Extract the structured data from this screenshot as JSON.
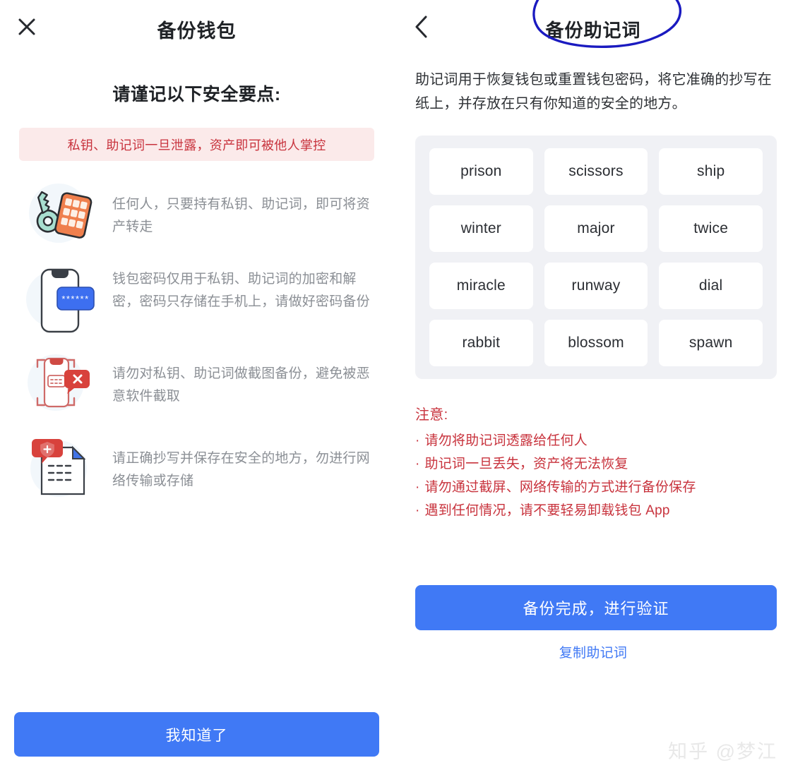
{
  "left_panel": {
    "nav": {
      "close_icon": "close-icon",
      "title": "备份钱包"
    },
    "heading": "请谨记以下安全要点:",
    "alert_banner": {
      "text": "私钥、助记词一旦泄露，资产即可被他人掌控",
      "bg_color": "#fbeaea",
      "text_color": "#c8333d"
    },
    "tips": [
      {
        "icon": "key-and-keypad-icon",
        "text": "任何人，只要持有私钥、助记词，即可将资产转走"
      },
      {
        "icon": "phone-password-icon",
        "text": "钱包密码仅用于私钥、助记词的加密和解密，密码只存储在手机上，请做好密码备份"
      },
      {
        "icon": "no-screenshot-icon",
        "text": "请勿对私钥、助记词做截图备份，避免被恶意软件截取"
      },
      {
        "icon": "secure-document-icon",
        "text": "请正确抄写并保存在安全的地方，勿进行网络传输或存储"
      }
    ],
    "primary_button": "我知道了"
  },
  "right_panel": {
    "nav": {
      "back_icon": "chevron-left-icon",
      "title": "备份助记词"
    },
    "annotation": {
      "shape": "hand-drawn-circle",
      "color": "#1a1ac0"
    },
    "intro": "助记词用于恢复钱包或重置钱包密码，将它准确的抄写在纸上，并存放在只有你知道的安全的地方。",
    "mnemonic_words": [
      "prison",
      "scissors",
      "ship",
      "winter",
      "major",
      "twice",
      "miracle",
      "runway",
      "dial",
      "rabbit",
      "blossom",
      "spawn"
    ],
    "notice": {
      "title": "注意:",
      "items": [
        "请勿将助记词透露给任何人",
        "助记词一旦丢失，资产将无法恢复",
        "请勿通过截屏、网络传输的方式进行备份保存",
        "遇到任何情况，请不要轻易卸载钱包 App"
      ],
      "bullet": "·",
      "color": "#c8333d"
    },
    "verify_button": "备份完成，进行验证",
    "copy_link": "复制助记词"
  },
  "watermark": "知乎 @梦江",
  "theme": {
    "accent_blue": "#4079f5",
    "alert_red": "#c8333d",
    "body_gray": "#8b8f95",
    "grid_bg": "#f0f1f5",
    "annotation_blue": "#1a1ac0"
  }
}
